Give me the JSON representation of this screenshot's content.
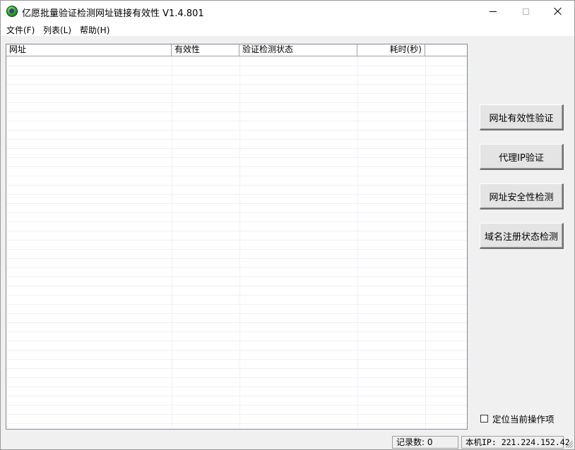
{
  "window": {
    "title": "亿愿批量验证检测网址链接有效性 V1.4.801"
  },
  "menu": [
    {
      "label": "文件(F)"
    },
    {
      "label": "列表(L)"
    },
    {
      "label": "帮助(H)"
    }
  ],
  "table": {
    "columns": [
      {
        "label": "网址"
      },
      {
        "label": "有效性"
      },
      {
        "label": "验证检测状态"
      },
      {
        "label": "耗时(秒)"
      },
      {
        "label": ""
      }
    ],
    "rows": []
  },
  "actions": {
    "validate_urls": "网址有效性验证",
    "validate_proxy": "代理IP验证",
    "security_check": "网址安全性检测",
    "domain_check": "域名注册状态检测"
  },
  "options": {
    "locate_current_label": "定位当前操作项",
    "locate_current_checked": false
  },
  "status": {
    "record_count": "记录数: 0",
    "local_ip": "本机IP: 221.224.152.42"
  },
  "colors": {
    "window_bg": "#f0f0f0",
    "list_bg": "#ffffff",
    "grid_line": "#eef0f4"
  }
}
